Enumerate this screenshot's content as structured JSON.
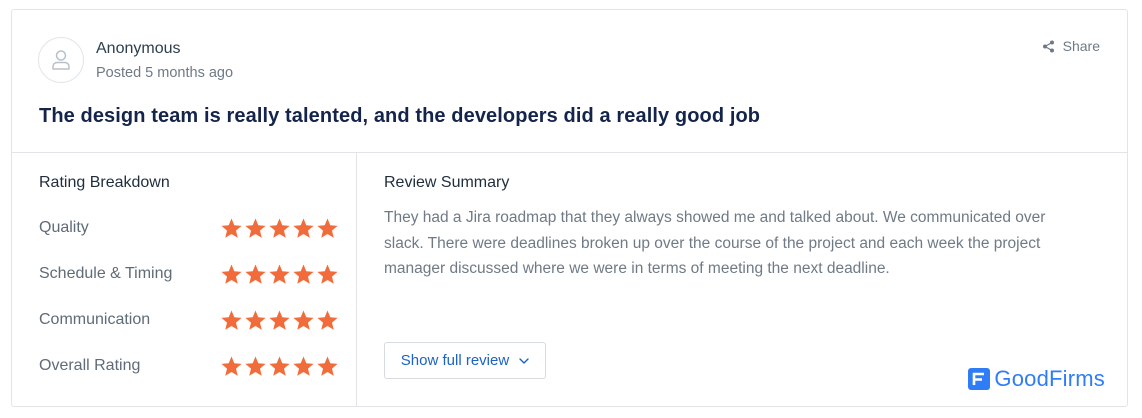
{
  "review": {
    "author": "Anonymous",
    "posted": "Posted 5 months ago",
    "share_label": "Share",
    "title": "The design team is really talented, and the developers did a really good job"
  },
  "breakdown": {
    "heading": "Rating Breakdown",
    "items": [
      {
        "label": "Quality",
        "stars": 5
      },
      {
        "label": "Schedule & Timing",
        "stars": 5
      },
      {
        "label": "Communication",
        "stars": 5
      },
      {
        "label": "Overall Rating",
        "stars": 5
      }
    ],
    "star_color": "#f26b3a"
  },
  "summary": {
    "heading": "Review Summary",
    "text": "They had a Jira roadmap that they always showed me and talked about. We communicated over slack. There were deadlines broken up over the course of the project and each week the project manager discussed where we were in terms of meeting the next deadline.",
    "button_label": "Show full review",
    "button_icon": "chevron-down-icon"
  },
  "brand": {
    "name": "GoodFirms",
    "color": "#2f7df6"
  }
}
